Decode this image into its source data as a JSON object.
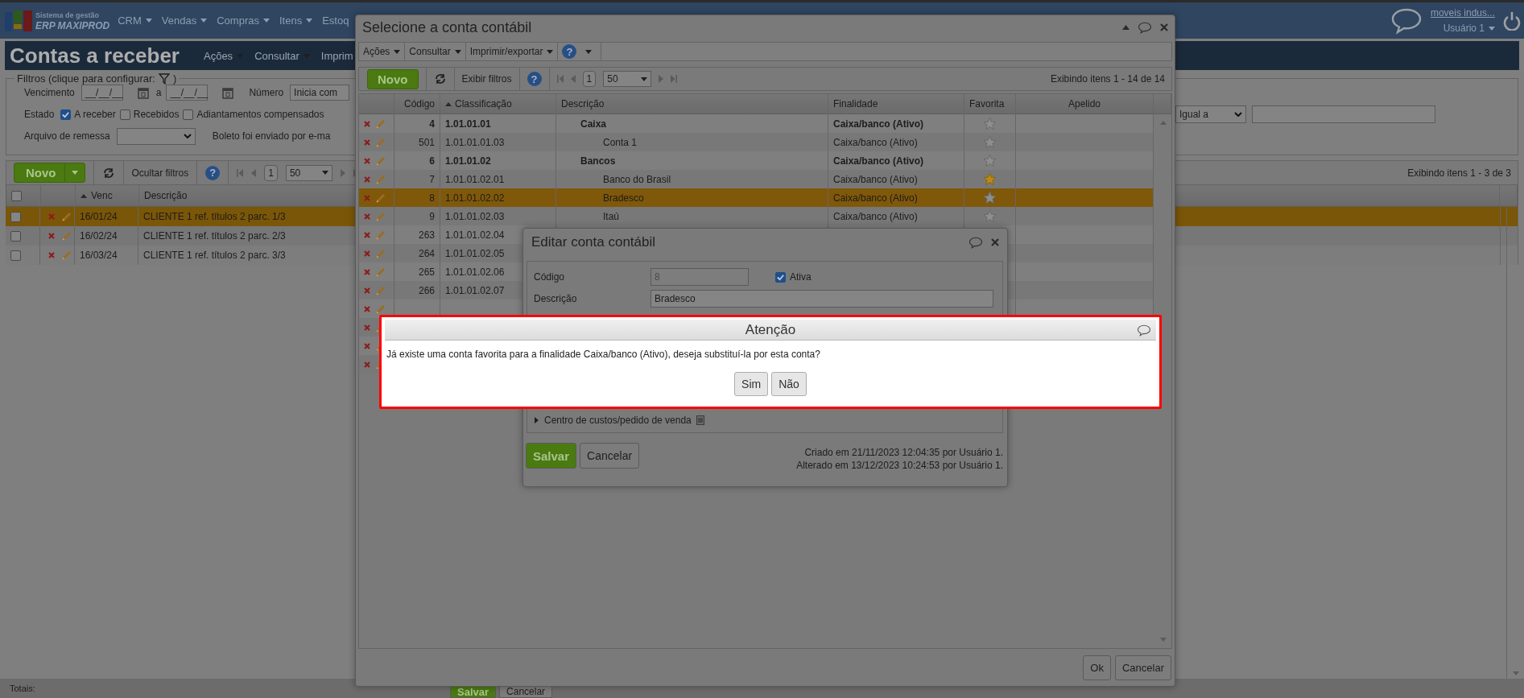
{
  "header": {
    "logo_subtitle": "Sistema de gestão",
    "logo_title": "ERP MAXIPROD",
    "menu": [
      {
        "label": "CRM",
        "dropdown": true
      },
      {
        "label": "Vendas",
        "dropdown": true
      },
      {
        "label": "Compras",
        "dropdown": true
      },
      {
        "label": "Itens",
        "dropdown": true
      },
      {
        "label": "Estoq",
        "dropdown": false
      }
    ],
    "company": "moveis indus...",
    "user": "Usuário 1"
  },
  "page": {
    "title": "Contas a receber",
    "menu": [
      {
        "label": "Ações",
        "dropdown": true
      },
      {
        "label": "Consultar",
        "dropdown": true
      },
      {
        "label": "Imprim",
        "dropdown": false
      }
    ],
    "filters": {
      "legend": "Filtros (clique para configurar:",
      "legend_end": ")",
      "due_label": "Vencimento",
      "date_from": "__/__/__",
      "range_word": "a",
      "date_to": "__/__/__",
      "number_label": "Número",
      "number_mode": "Inicia com",
      "state_label": "Estado",
      "states": [
        {
          "label": "A receber",
          "checked": true
        },
        {
          "label": "Recebidos",
          "checked": false
        },
        {
          "label": "Adiantamentos compensados",
          "checked": false
        }
      ],
      "match_mode": "Igual a",
      "file_label": "Arquivo de remessa",
      "boleto_label": "Boleto foi enviado por e-ma"
    },
    "toolbar": {
      "new": "Novo",
      "toggle_filters": "Ocultar filtros",
      "help": "?",
      "page": "1",
      "page_size": "50",
      "summary": "Exibindo itens 1 - 3 de 3"
    },
    "table": {
      "columns": [
        "Venc",
        "Descrição"
      ],
      "all_checked": false,
      "rows": [
        {
          "selected": true,
          "checked": false,
          "venc": "16/01/24",
          "descricao": "CLIENTE 1 ref. títulos 2 parc. 1/3"
        },
        {
          "selected": false,
          "checked": false,
          "venc": "16/02/24",
          "descricao": "CLIENTE 1 ref. títulos 2 parc. 2/3"
        },
        {
          "selected": false,
          "checked": false,
          "venc": "16/03/24",
          "descricao": "CLIENTE 1 ref. títulos 2 parc. 3/3"
        }
      ]
    },
    "footer": "Totais:"
  },
  "select_dialog": {
    "title": "Selecione a conta contábil",
    "menu": [
      "Ações",
      "Consultar",
      "Imprimir/exportar"
    ],
    "help": "?",
    "toolbar": {
      "new": "Novo",
      "toggle_filters": "Exibir filtros",
      "help": "?",
      "page": "1",
      "page_size": "50",
      "summary": "Exibindo itens 1 - 14 de 14"
    },
    "table": {
      "columns": [
        "Código",
        "Classificação",
        "Descrição",
        "Finalidade",
        "Favorita",
        "Apelido"
      ],
      "rows": [
        {
          "kind": "account",
          "selected": false,
          "codigo": "4",
          "classificacao": "1.01.01.01",
          "descricao": "Caixa",
          "finalidade": "Caixa/banco (Ativo)",
          "favorite": false,
          "children": [
            {
              "kind": "account",
              "selected": false,
              "codigo": "501",
              "classificacao": "1.01.01.01.03",
              "descricao": "Conta 1",
              "finalidade": "Caixa/banco (Ativo)",
              "favorite": false
            }
          ]
        },
        {
          "kind": "account",
          "selected": false,
          "codigo": "6",
          "classificacao": "1.01.01.02",
          "descricao": "Bancos",
          "finalidade": "Caixa/banco (Ativo)",
          "favorite": false,
          "children": [
            {
              "kind": "account",
              "selected": false,
              "codigo": "7",
              "classificacao": "1.01.01.02.01",
              "descricao": "Banco do Brasil",
              "finalidade": "Caixa/banco (Ativo)",
              "favorite": true
            },
            {
              "kind": "account",
              "selected": true,
              "codigo": "8",
              "classificacao": "1.01.01.02.02",
              "descricao": "Bradesco",
              "finalidade": "Caixa/banco (Ativo)",
              "favorite": false
            },
            {
              "kind": "account",
              "selected": false,
              "codigo": "9",
              "classificacao": "1.01.01.02.03",
              "descricao": "Itaú",
              "finalidade": "Caixa/banco (Ativo)",
              "favorite": false
            },
            {
              "kind": "account",
              "selected": false,
              "codigo": "263",
              "classificacao": "1.01.01.02.04"
            },
            {
              "kind": "account",
              "selected": false,
              "codigo": "264",
              "classificacao": "1.01.01.02.05"
            },
            {
              "kind": "account",
              "selected": false,
              "codigo": "265",
              "classificacao": "1.01.01.02.06"
            },
            {
              "kind": "account",
              "selected": false,
              "codigo": "266",
              "classificacao": "1.01.01.02.07"
            },
            {
              "kind": "covered",
              "selected": false
            },
            {
              "kind": "covered",
              "selected": false
            },
            {
              "kind": "covered",
              "selected": false
            },
            {
              "kind": "covered",
              "selected": false
            }
          ]
        }
      ]
    },
    "buttons": [
      "Ok",
      "Cancelar"
    ]
  },
  "edit_dialog": {
    "title": "Editar conta contábil",
    "fields": [
      {
        "label": "Código",
        "value": "8",
        "disabled": true
      },
      {
        "label": "Descrição",
        "value": "Bradesco",
        "disabled": false
      }
    ],
    "active": {
      "label": "Ativa",
      "checked": true
    },
    "sections": [
      {
        "label": "Centro de custos/pedido de venda",
        "expanded": false
      }
    ],
    "buttons": [
      "Salvar",
      "Cancelar"
    ],
    "created": "Criado em 21/11/2023 12:04:35 por Usuário 1.",
    "modified": "Alterado em 13/12/2023 10:24:53 por Usuário 1."
  },
  "alert": {
    "title": "Atenção",
    "message": "Já existe uma conta favorita para a finalidade Caixa/banco (Ativo), deseja substituí-la por esta conta?",
    "buttons": [
      "Sim",
      "Não"
    ]
  },
  "back_form": {
    "buttons": [
      "Salvar",
      "Cancelar"
    ]
  }
}
